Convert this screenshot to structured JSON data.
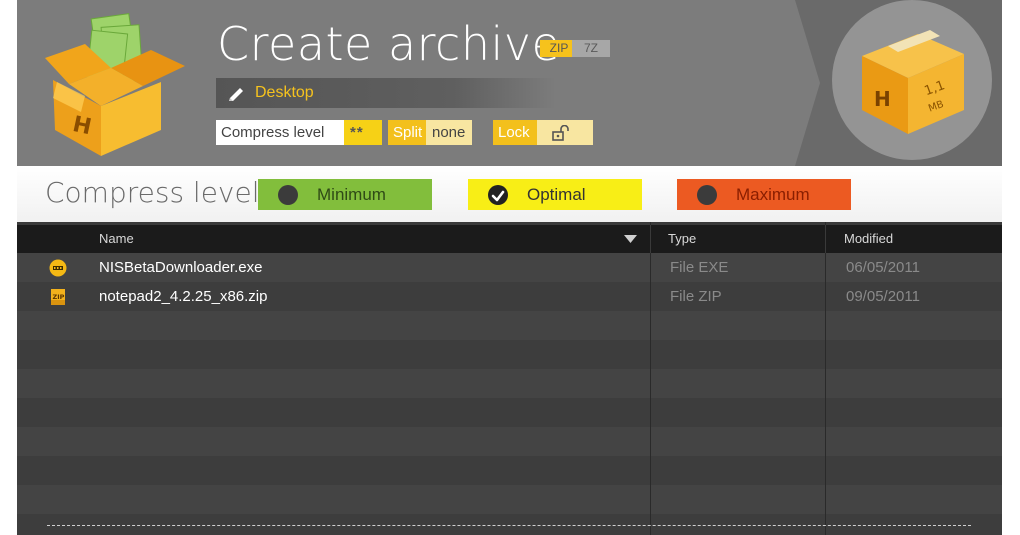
{
  "header": {
    "title": "Create archive",
    "formats": [
      "ZIP",
      "7Z"
    ],
    "selected_format": "ZIP",
    "path": "Desktop",
    "options": {
      "compress_label": "Compress level",
      "compress_value": "**",
      "split_label": "Split",
      "split_value": "none",
      "lock_label": "Lock"
    },
    "size": {
      "value": "1,1",
      "unit": "MB",
      "box_letter": "H"
    }
  },
  "compress_level": {
    "title": "Compress level:",
    "options": [
      "Minimum",
      "Optimal",
      "Maximum"
    ],
    "selected": "Optimal"
  },
  "table": {
    "columns": [
      "Name",
      "Type",
      "Modified"
    ],
    "rows": [
      {
        "name": "NISBetaDownloader.exe",
        "type": "File EXE",
        "modified": "06/05/2011",
        "icon": "exe-file-icon"
      },
      {
        "name": "notepad2_4.2.25_x86.zip",
        "type": "File ZIP",
        "modified": "09/05/2011",
        "icon": "zip-file-icon"
      }
    ]
  },
  "colors": {
    "accent_yellow": "#f6c21c",
    "minimum": "#82be3c",
    "optimal": "#f8ee16",
    "maximum": "#ec5a22"
  }
}
